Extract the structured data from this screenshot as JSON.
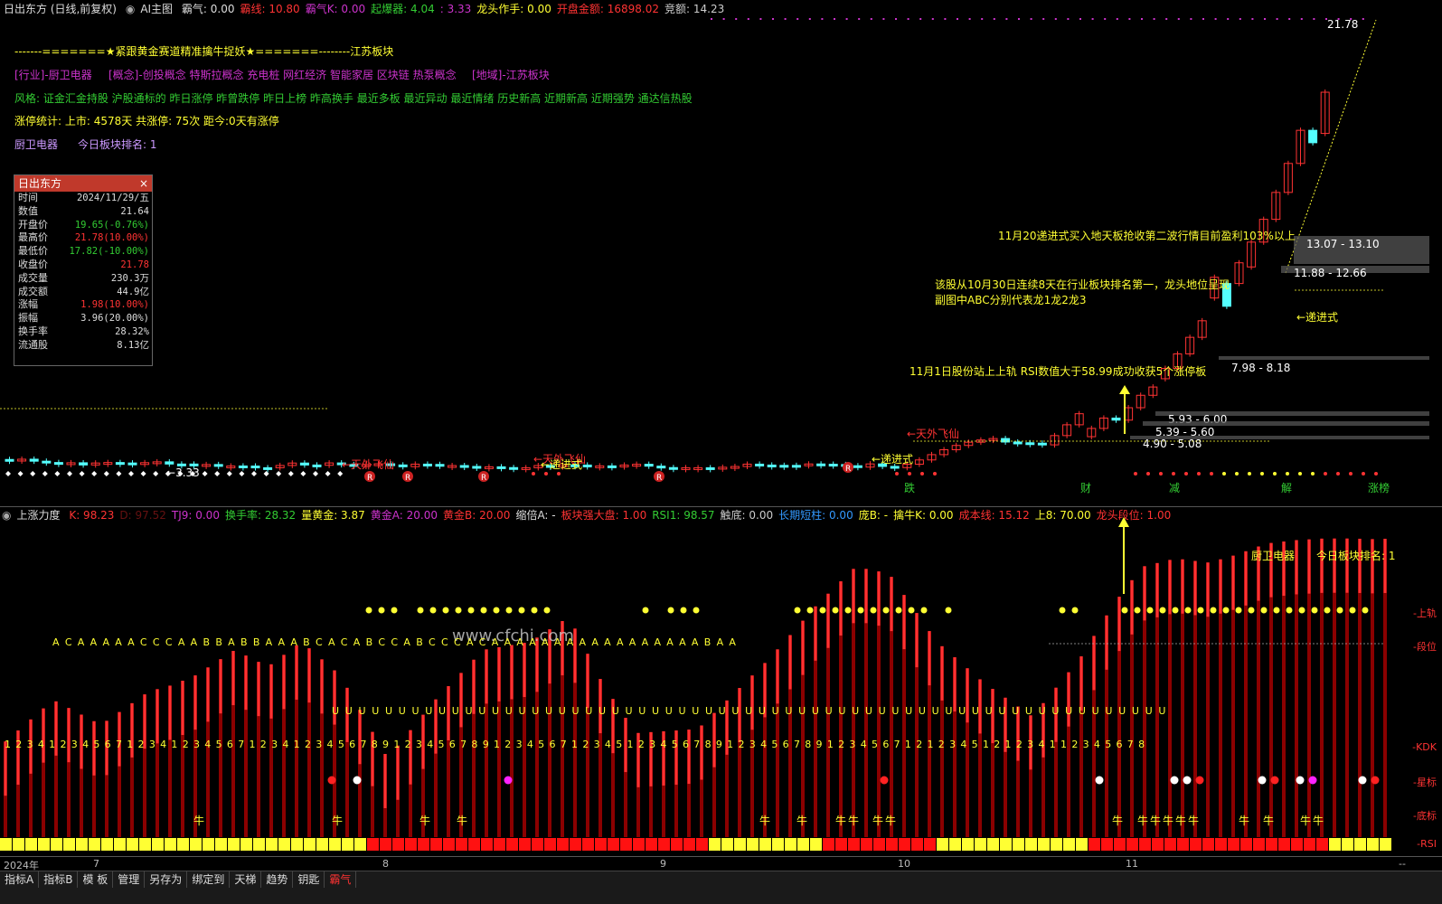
{
  "header": {
    "title": "日出东方 (日线,前复权)",
    "ai_label": "AI主图",
    "items": [
      {
        "text": "霸气: 0.00",
        "color": "#dddddd"
      },
      {
        "text": "霸线: 10.80",
        "color": "#ff3333"
      },
      {
        "text": "霸气K: 0.00",
        "color": "#cc33cc"
      },
      {
        "text": "起爆器: 4.04",
        "color": "#33cc33"
      },
      {
        "text": ": 3.33",
        "color": "#cc33cc"
      },
      {
        "text": "龙头作手: 0.00",
        "color": "#ffff33"
      },
      {
        "text": "开盘金额: 16898.02",
        "color": "#ff3333"
      },
      {
        "text": "竞额: 14.23",
        "color": "#cccccc"
      }
    ]
  },
  "info": {
    "banner": "-------=======★紧跟黄金赛道精准擒牛捉妖★=======--------江苏板块",
    "industry": "[行业]-厨卫电器",
    "concept": "[概念]-创投概念 特斯拉概念 充电桩 网红经济 智能家居 区块链 热泵概念",
    "region": "[地域]-江苏板块",
    "style": "风格: 证金汇金持股 沪股通标的 昨日涨停 昨曾跌停 昨日上榜 昨高换手 最近多板 最近异动 最近情绪 历史新高 近期新高 近期强势 通达信热股",
    "limit_stats": "涨停统计:    上市: 4578天    共涨停: 75次    距今:0天有涨停",
    "sector": "厨卫电器",
    "rank": "今日板块排名:  1"
  },
  "panel": {
    "title": "日出东方",
    "close": "×",
    "rows": [
      {
        "k": "时间",
        "v": "2024/11/29/五",
        "c": "#dddddd"
      },
      {
        "k": "数值",
        "v": "21.64",
        "c": "#dddddd"
      },
      {
        "k": "开盘价",
        "v": "19.65(-0.76%)",
        "c": "#33cc33"
      },
      {
        "k": "最高价",
        "v": "21.78(10.00%)",
        "c": "#ff3333"
      },
      {
        "k": "最低价",
        "v": "17.82(-10.00%)",
        "c": "#33cc33"
      },
      {
        "k": "收盘价",
        "v": "21.78",
        "c": "#ff3333"
      },
      {
        "k": "成交量",
        "v": "230.3万",
        "c": "#dddddd"
      },
      {
        "k": "成交额",
        "v": "44.9亿",
        "c": "#dddddd"
      },
      {
        "k": "涨幅",
        "v": "1.98(10.00%)",
        "c": "#ff3333"
      },
      {
        "k": "振幅",
        "v": "3.96(20.00%)",
        "c": "#dddddd"
      },
      {
        "k": "换手率",
        "v": "28.32%",
        "c": "#dddddd"
      },
      {
        "k": "流通股",
        "v": "8.13亿",
        "c": "#dddddd"
      }
    ]
  },
  "annotations": {
    "a1": "11月20递进式买入地天板抢收第二波行情目前盈利103%以上",
    "a2_line1": "该股从10月30日连续8天在行业板块排名第一，龙头地位呈现",
    "a2_line2": "副图中ABC分别代表龙1龙2龙3",
    "a3": "11月1日股份站上上轨 RSI数值大于58.99成功收获5个涨停板",
    "high_label": "21.78",
    "low_label": "3.33",
    "zones": [
      "13.07 - 13.10",
      "11.88 - 12.66",
      "7.98 - 8.18",
      "5.93 - 6.00",
      "5.39 - 5.60",
      "4.90 - 5.08"
    ],
    "tianwai": "天外飞仙",
    "dijin": "递进式",
    "bottom_tags": [
      "跌",
      "财",
      "减",
      "解",
      "涨榜"
    ],
    "watermark": "www.cfchi.com"
  },
  "sub": {
    "title": "上涨力度",
    "items": [
      {
        "text": "K: 98.23",
        "color": "#ff3333"
      },
      {
        "text": "D: 97.52",
        "color": "#661111"
      },
      {
        "text": "TJ9: 0.00",
        "color": "#cc33cc"
      },
      {
        "text": "换手率: 28.32",
        "color": "#33cc33"
      },
      {
        "text": "量黄金: 3.87",
        "color": "#ffff33"
      },
      {
        "text": "黄金A: 20.00",
        "color": "#cc33cc"
      },
      {
        "text": "黄金B: 20.00",
        "color": "#ff3333"
      },
      {
        "text": "缩倍A: -",
        "color": "#dddddd"
      },
      {
        "text": "板块强大盘: 1.00",
        "color": "#ff3333"
      },
      {
        "text": "RSI1: 98.57",
        "color": "#33cc33"
      },
      {
        "text": "触底: 0.00",
        "color": "#cccccc"
      },
      {
        "text": "长期短柱: 0.00",
        "color": "#3399ff"
      },
      {
        "text": "庞B: -",
        "color": "#ffff33"
      },
      {
        "text": "擒牛K: 0.00",
        "color": "#ffff33"
      },
      {
        "text": "成本线: 15.12",
        "color": "#ff3333"
      },
      {
        "text": "上8: 70.00",
        "color": "#ffff33"
      },
      {
        "text": "龙头段位: 1.00",
        "color": "#ff3333"
      }
    ],
    "sector": "厨卫电器",
    "rank": "今日板块排名:  1",
    "right_labels": [
      "上轨",
      "段位",
      "KDK",
      "星标",
      "底标",
      "RSI"
    ],
    "abc_marks": "A C A       A   A A   A C C C   A   A  B B  A B B A A  A B   C A  C  A  B  C C   A    B                 C C       C A C  A A A A A A A   A A A A A   A A A A A B A A",
    "u_marks": "U      U U   U U U U U U U U U U U U U               U U U U U U U U U U U U U U U U U U U U U U U U U U U U         U U U U U U U U U U U U U U U U U U U",
    "count_marks": "1 2 3 4 1 2 3 4 5 6 7 1 2 3 4 1 2 3 4 5 6 7 1 2 3 4 1 2 3 4 5 6 7 8 9       1 2 3 4 5 6 7 8 9   1 2 3 4 5 6 7 1 2 3 4 5 1 2 3 4 5 6 7 8 9 1 2 3 4 5 6 7 8 9 1 2 3 4 5 6 7 1 2 1 2 3 4 5 1 2 1 2 3 4 1 1 2 3 4 5 6 7 8",
    "niu": "牛"
  },
  "date_axis": {
    "labels": [
      "2024年",
      "7",
      "8",
      "9",
      "10",
      "11"
    ],
    "right": "--"
  },
  "tabs": [
    "指标A",
    "指标B",
    "模 板",
    "管理",
    "另存为",
    "绑定到",
    "天梯",
    "趋势",
    "钥匙",
    "霸气"
  ],
  "colors": {
    "up": "#ff3333",
    "down": "#54ffff",
    "yellow": "#ffff33",
    "purple": "#cc33cc",
    "green": "#33cc33"
  }
}
